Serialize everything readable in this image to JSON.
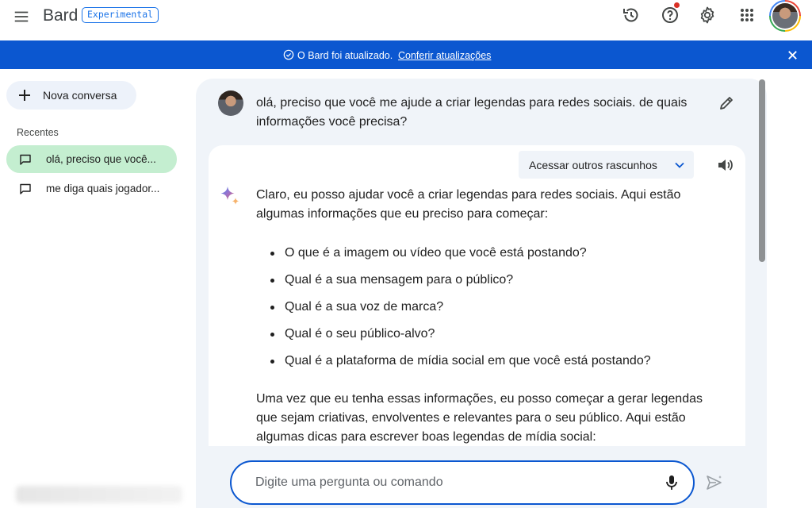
{
  "app": {
    "brand": "Bard",
    "badge": "Experimental",
    "icons": {
      "menu": "menu-icon",
      "history": "history-icon",
      "help": "help-icon",
      "settings": "gear-icon",
      "apps": "apps-grid-icon",
      "account": "avatar"
    }
  },
  "banner": {
    "text": "O Bard foi atualizado.",
    "link": "Conferir atualizações"
  },
  "sidebar": {
    "new_chat": "Nova conversa",
    "recent_title": "Recentes",
    "items": [
      {
        "label": "olá, preciso que você..."
      },
      {
        "label": "me diga quais jogador..."
      }
    ]
  },
  "conversation": {
    "user_message": "olá, preciso que você me ajude a criar legendas para redes sociais. de quais informações você precisa?",
    "drafts_button": "Acessar outros rascunhos",
    "response_intro": "Claro, eu posso ajudar você a criar legendas para redes sociais. Aqui estão algumas informações que eu preciso para começar:",
    "response_list": [
      "O que é a imagem ou vídeo que você está postando?",
      "Qual é a sua mensagem para o público?",
      "Qual é a sua voz de marca?",
      "Qual é o seu público-alvo?",
      "Qual é a plataforma de mídia social em que você está postando?"
    ],
    "response_outro": "Uma vez que eu tenha essas informações, eu posso começar a gerar legendas que sejam criativas, envolventes e relevantes para o seu público. Aqui estão algumas dicas para escrever boas legendas de mídia social:"
  },
  "input": {
    "placeholder": "Digite uma pergunta ou comando",
    "value": ""
  },
  "colors": {
    "accent": "#0b57d0",
    "active_item": "#c4eed0",
    "surface": "#f0f4f9"
  }
}
